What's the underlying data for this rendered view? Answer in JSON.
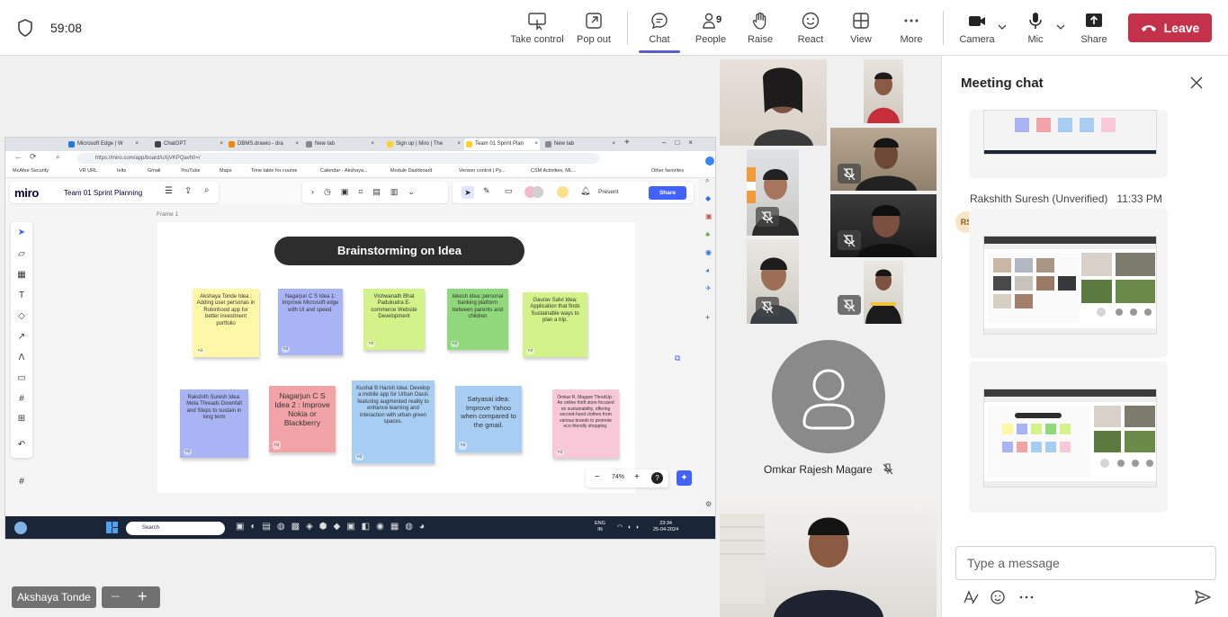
{
  "meeting": {
    "timer": "59:08",
    "toolbar": {
      "take_control": "Take control",
      "pop_out": "Pop out",
      "chat": "Chat",
      "people": "People",
      "people_count": "9",
      "raise": "Raise",
      "react": "React",
      "view": "View",
      "more": "More",
      "camera": "Camera",
      "mic": "Mic",
      "share": "Share",
      "leave": "Leave"
    },
    "colors": {
      "accent": "#5b5fc7",
      "leave": "#c4314b"
    }
  },
  "shared_screen": {
    "presenter": "Akshaya Tonde",
    "browser": {
      "tabs": [
        {
          "label": "Microsoft Edge | W",
          "active": false
        },
        {
          "label": "ChatGPT",
          "active": false
        },
        {
          "label": "DBMS.drawio - dra",
          "active": false
        },
        {
          "label": "New tab",
          "active": false
        },
        {
          "label": "Sign up | Miro | The",
          "active": false
        },
        {
          "label": "Team 01 Sprint Plan",
          "active": true
        },
        {
          "label": "New tab",
          "active": false
        }
      ],
      "url": "https://miro.com/app/board/uXjVKPQavh0=/",
      "bookmarks": [
        "McAfee Security",
        "VR URL",
        "Ielts",
        "Gmail",
        "YouTube",
        "Maps",
        "Time table for course",
        "Calendar - Akshaya...",
        "Module Dashboard",
        "Version control | Py...",
        "CSM Activities, ML...",
        "Other favorites"
      ]
    },
    "miro": {
      "logo": "miro",
      "board_name": "Team 01 Sprint Planning",
      "present": "Present",
      "share": "Share",
      "frame_label": "Frame 1",
      "title": "Brainstorming on Idea",
      "zoom": "74%",
      "stickies": [
        {
          "text": "Akshaya Tonde Idea : Adding user personas in Robinhood app for better investment portfolio",
          "color": "#fff7a8"
        },
        {
          "text": "Nagarjun C S Idea 1: Improve Microsoft edge with UI and speed.",
          "color": "#a9b4f5"
        },
        {
          "text": "Vishwanath Bhat Padukudra E-commerce Website Development",
          "color": "#d4f28a"
        },
        {
          "text": "lokesh idea::personal banking platform between parents and children",
          "color": "#8fd97c"
        },
        {
          "text": "Gaurav Salvi Idea: Application that finds Sustainable ways to plan a trip.",
          "color": "#d4f28a"
        },
        {
          "text": "Rakshith Suresh Idea: Meta Threads Downfall and Steps to sustain in long term",
          "color": "#a9b4f5"
        },
        {
          "text": "Nagarjun C S Idea 2 : Improve Nokia or Blackberry",
          "color": "#f2a3a8"
        },
        {
          "text": "Kushal B Harish Idea: Develop a mobile app for Urban Oasis featuring augmented reality to enhance learning and interaction with urban green spaces.",
          "color": "#a8cdf2"
        },
        {
          "text": "Satyasai idea: Improve Yahoo when compared to the gmail.",
          "color": "#a8cdf2"
        },
        {
          "text": "Omkar R. Magare ThredUp : An online thrift store focused on sustainability, offering second-hand clothes from various brands to promote eco-friendly shopping.",
          "color": "#f8c8d8"
        }
      ]
    },
    "taskbar": {
      "search": "Search",
      "lang": "ENG",
      "region": "IN",
      "time": "23:34",
      "date": "25-04-2024"
    }
  },
  "gallery": {
    "omkar_name": "Omkar Rajesh Magare"
  },
  "chat": {
    "title": "Meeting chat",
    "message": {
      "sender": "Rakshith Suresh (Unverified)",
      "time": "11:33 PM",
      "initials": "RS"
    },
    "compose_placeholder": "Type a message"
  }
}
